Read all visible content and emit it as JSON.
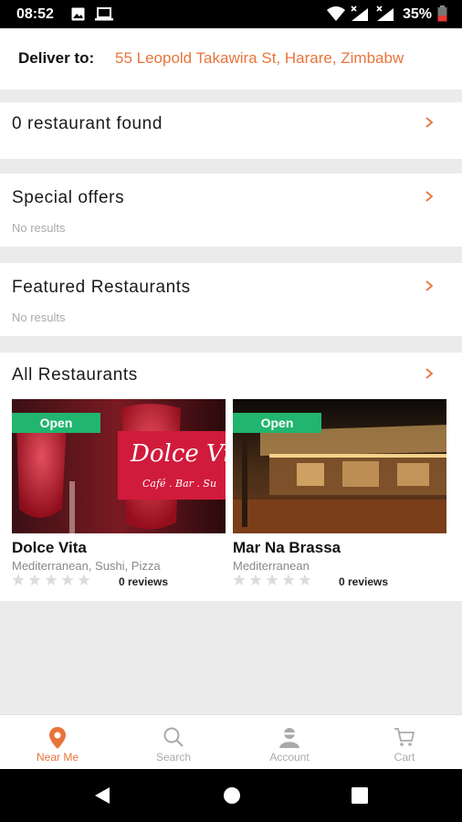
{
  "status_bar": {
    "time": "08:52",
    "battery": "35%"
  },
  "deliver": {
    "label": "Deliver to:",
    "address": "55 Leopold Takawira St, Harare, Zimbabw"
  },
  "restaurants_found": {
    "title": "0 restaurant found"
  },
  "special_offers": {
    "title": "Special offers",
    "subtitle": "No results"
  },
  "featured": {
    "title": "Featured Restaurants",
    "subtitle": "No results"
  },
  "all_restaurants": {
    "title": "All Restaurants",
    "items": [
      {
        "name": "Dolce Vita",
        "cuisine": "Mediterranean, Sushi, Pizza",
        "status": "Open",
        "reviews": "0 reviews",
        "rating": 0,
        "sign_text": "Dolce Vi",
        "sign_sub": "Café . Bar . Su"
      },
      {
        "name": "Mar Na Brassa",
        "cuisine": "Mediterranean",
        "status": "Open",
        "reviews": "0 reviews",
        "rating": 0
      }
    ]
  },
  "bottom_nav": [
    {
      "label": "Near Me",
      "icon": "location-pin-icon",
      "active": true
    },
    {
      "label": "Search",
      "icon": "search-icon",
      "active": false
    },
    {
      "label": "Account",
      "icon": "account-icon",
      "active": false
    },
    {
      "label": "Cart",
      "icon": "cart-icon",
      "active": false
    }
  ],
  "colors": {
    "accent": "#e8743b",
    "open_badge": "#21b56f",
    "inactive_nav": "#aaaaaa"
  }
}
